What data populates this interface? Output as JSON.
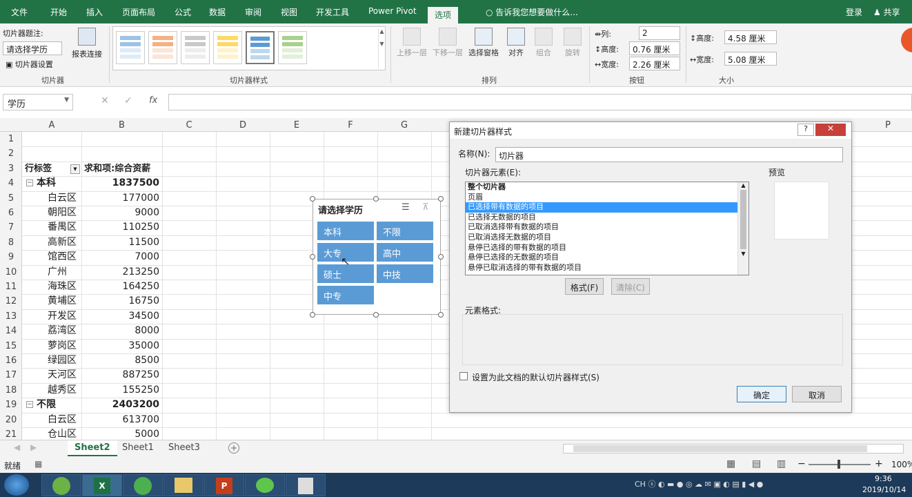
{
  "ribbon_tabs": [
    "文件",
    "开始",
    "插入",
    "页面布局",
    "公式",
    "数据",
    "审阅",
    "视图",
    "开发工具",
    "Power Pivot",
    "选项"
  ],
  "tell_me": "告诉我您想要做什么...",
  "login": "登录",
  "share": "共享",
  "slicer_group": {
    "caption_label": "切片器题注:",
    "caption_value": "请选择学历",
    "settings": "切片器设置",
    "report_link": "报表连接",
    "group_label": "切片器"
  },
  "styles_group_label": "切片器样式",
  "arrange": {
    "up": "上移一层",
    "down": "下移一层",
    "selection_pane": "选择窗格",
    "align": "对齐",
    "group": "组合",
    "rotate": "旋转",
    "group_label": "排列"
  },
  "buttons_group": {
    "columns_label": "列:",
    "columns": "2",
    "height_label": "高度:",
    "height": "0.76 厘米",
    "width_label": "宽度:",
    "width": "2.26 厘米",
    "group_label": "按钮"
  },
  "size_group": {
    "height_label": "高度:",
    "height": "4.58 厘米",
    "width_label": "宽度:",
    "width": "5.08 厘米",
    "group_label": "大小"
  },
  "name_box": "学历",
  "columns": [
    "A",
    "B",
    "C",
    "D",
    "E",
    "F",
    "G",
    "P"
  ],
  "rows": [
    "1",
    "2",
    "3",
    "4",
    "5",
    "6",
    "7",
    "8",
    "9",
    "10",
    "11",
    "12",
    "13",
    "14",
    "15",
    "16",
    "17",
    "18",
    "19",
    "20",
    "21"
  ],
  "pivot_header": {
    "label": "行标签",
    "value": "求和项:综合资薪"
  },
  "pivot_rows": [
    {
      "label": "本科",
      "value": "1837500",
      "group": true
    },
    {
      "label": "白云区",
      "value": "177000"
    },
    {
      "label": "朝阳区",
      "value": "9000"
    },
    {
      "label": "番禺区",
      "value": "110250"
    },
    {
      "label": "高新区",
      "value": "11500"
    },
    {
      "label": "馆西区",
      "value": "7000"
    },
    {
      "label": "广州",
      "value": "213250"
    },
    {
      "label": "海珠区",
      "value": "164250"
    },
    {
      "label": "黄埔区",
      "value": "16750"
    },
    {
      "label": "开发区",
      "value": "34500"
    },
    {
      "label": "荔湾区",
      "value": "8000"
    },
    {
      "label": "萝岗区",
      "value": "35000"
    },
    {
      "label": "绿园区",
      "value": "8500"
    },
    {
      "label": "天河区",
      "value": "887250"
    },
    {
      "label": "越秀区",
      "value": "155250"
    },
    {
      "label": "不限",
      "value": "2403200",
      "group": true
    },
    {
      "label": "白云区",
      "value": "613700"
    },
    {
      "label": "仓山区",
      "value": "5000"
    }
  ],
  "slicer": {
    "title": "请选择学历",
    "items": [
      "本科",
      "不限",
      "大专",
      "高中",
      "硕士",
      "中技",
      "中专"
    ]
  },
  "dialog": {
    "title": "新建切片器样式",
    "name_label": "名称(N):",
    "name_value": "切片器",
    "elements_label": "切片器元素(E):",
    "preview_label": "预览",
    "elements": [
      "整个切片器",
      "页眉",
      "已选择带有数据的项目",
      "已选择无数据的项目",
      "已取消选择带有数据的项目",
      "已取消选择无数据的项目",
      "悬停已选择的带有数据的项目",
      "悬停已选择的无数据的项目",
      "悬停已取消选择的带有数据的项目"
    ],
    "format_btn": "格式(F)",
    "clear_btn": "清除(C)",
    "element_format_label": "元素格式:",
    "default_checkbox": "设置为此文档的默认切片器样式(S)",
    "ok": "确定",
    "cancel": "取消"
  },
  "sheet_tabs": [
    "Sheet2",
    "Sheet1",
    "Sheet3"
  ],
  "status": "就绪",
  "zoom": "100%",
  "clock": {
    "time": "9:36",
    "date": "2019/10/14"
  },
  "colors": {
    "excel_green": "#217346",
    "slicer_blue": "#5b9bd5",
    "selection_blue": "#3399ff"
  }
}
